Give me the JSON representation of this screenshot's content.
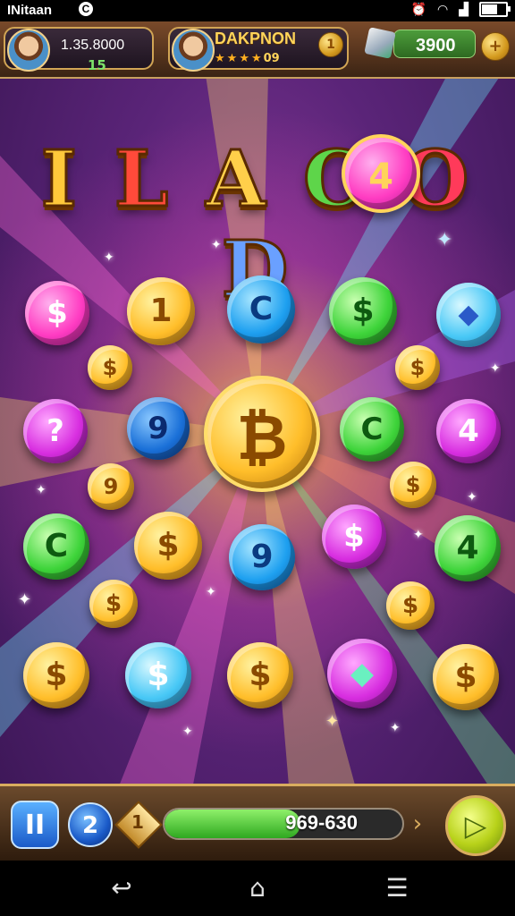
{
  "status_bar": {
    "carrier": "INitaan",
    "sync_icon": "sync-icon",
    "icons": [
      "alarm-icon",
      "wifi-icon",
      "signal-icon",
      "battery-icon"
    ]
  },
  "top_bar": {
    "player1": {
      "score": "1.35.8000",
      "level": "15"
    },
    "player2": {
      "name": "DAKPNON",
      "coin_label": "1",
      "level_text": "09"
    },
    "gems": {
      "count": "3900",
      "plus_label": "+"
    }
  },
  "title": {
    "letters": [
      "I",
      "L",
      "A",
      "C",
      "O",
      "D"
    ],
    "emblem_label": "4"
  },
  "board": {
    "coins": [
      {
        "color": "pink",
        "label": "$"
      },
      {
        "color": "gold",
        "label": "1"
      },
      {
        "color": "blue",
        "label": "C"
      },
      {
        "color": "green",
        "label": "$"
      },
      {
        "color": "cyan",
        "label": "◆"
      },
      {
        "color": "gold",
        "label": "$"
      },
      {
        "color": "gold",
        "label": "$"
      },
      {
        "color": "purple",
        "label": "?"
      },
      {
        "color": "darkblue",
        "label": "9"
      },
      {
        "color": "gold",
        "label": "₿"
      },
      {
        "color": "green",
        "label": "C"
      },
      {
        "color": "purple",
        "label": "4"
      },
      {
        "color": "gold",
        "label": "9"
      },
      {
        "color": "gold",
        "label": "$"
      },
      {
        "color": "green",
        "label": "C"
      },
      {
        "color": "gold",
        "label": "$"
      },
      {
        "color": "blue",
        "label": "9"
      },
      {
        "color": "purple",
        "label": "$"
      },
      {
        "color": "green",
        "label": "4"
      },
      {
        "color": "gold",
        "label": "$"
      },
      {
        "color": "gold",
        "label": "$"
      },
      {
        "color": "gold",
        "label": "$"
      },
      {
        "color": "cyan",
        "label": "$"
      },
      {
        "color": "gold",
        "label": "$"
      },
      {
        "color": "purple",
        "label": "◆"
      },
      {
        "color": "gold",
        "label": "$"
      }
    ]
  },
  "bottom_bar": {
    "pause_label": "II",
    "level": "2",
    "diamond_label": "1",
    "progress_text": "969-630",
    "progress_fraction": 0.57,
    "arrow_label": "›",
    "play_label": "▷"
  },
  "nav_bar": {
    "back": "↩",
    "home": "⌂",
    "recents": "☰"
  },
  "colors": {
    "accent_gold": "#d9ad5f",
    "progress_green": "#2ea820",
    "background": "#5a2478"
  }
}
